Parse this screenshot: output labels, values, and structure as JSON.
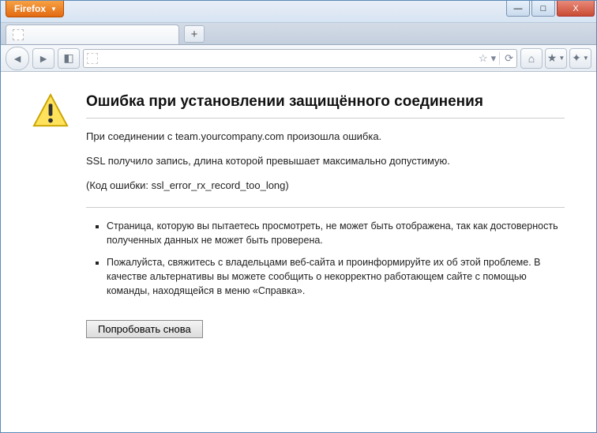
{
  "window": {
    "app_menu_label": "Firefox",
    "controls": {
      "minimize": "—",
      "maximize": "□",
      "close": "X"
    }
  },
  "tabs": {
    "active_title": "",
    "newtab_glyph": "+"
  },
  "navbar": {
    "back_glyph": "◄",
    "forward_glyph": "►",
    "feed_glyph": "◧",
    "bookmark_glyph": "☆",
    "reload_glyph": "⟳",
    "home_glyph": "⌂",
    "bookmarks_menu_glyph": "★",
    "addons_glyph": "✦"
  },
  "error": {
    "title": "Ошибка при установлении защищённого соединения",
    "line1": "При соединении с team.yourcompany.com произошла ошибка.",
    "line2": "SSL получило запись, длина которой превышает максимально допустимую.",
    "code": "(Код ошибки: ssl_error_rx_record_too_long)",
    "bullet1": "Страница, которую вы пытаетесь просмотреть, не может быть отображена, так как достоверность полученных данных не может быть проверена.",
    "bullet2": "Пожалуйста, свяжитесь с владельцами веб-сайта и проинформируйте их об этой проблеме. В качестве альтернативы вы можете сообщить о некорректно работающем сайте с помощью команды, находящейся в меню «Справка».",
    "retry_label": "Попробовать снова"
  }
}
